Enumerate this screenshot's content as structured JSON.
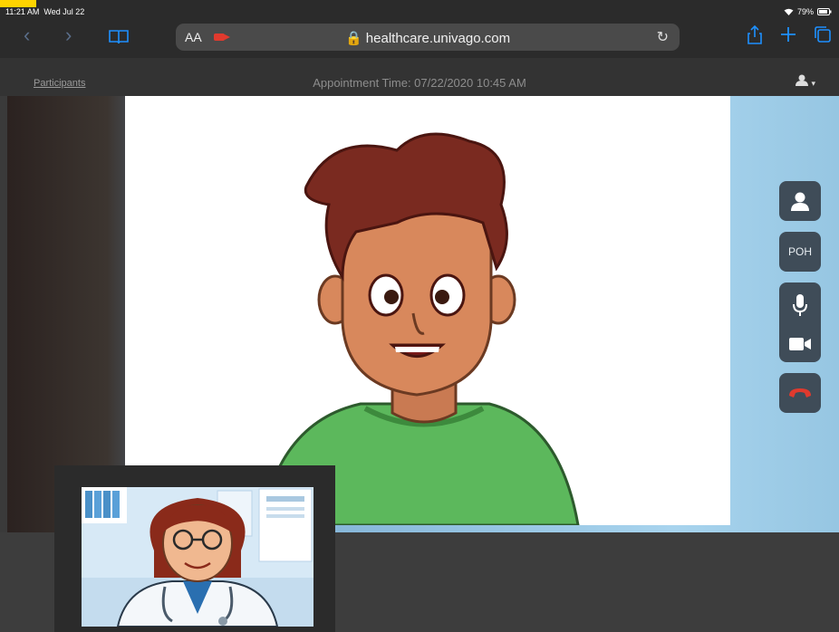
{
  "status_bar": {
    "time": "11:21 AM",
    "date": "Wed Jul 22",
    "battery": "79%",
    "wifi_icon": "wifi-icon",
    "battery_icon": "battery-icon"
  },
  "browser": {
    "text_size_label": "AA",
    "url": "healthcare.univago.com",
    "lock_icon": "lock-icon",
    "back_icon": "chevron-left-icon",
    "forward_icon": "chevron-right-icon",
    "bookmarks_icon": "book-icon",
    "reload_icon": "reload-icon",
    "share_icon": "share-icon",
    "new_tab_icon": "plus-icon",
    "tabs_icon": "tabs-icon",
    "accent": "#1e90ff"
  },
  "header": {
    "participants_label": "Participants",
    "appointment_label": "Appointment Time: 07/22/2020 10:45 AM",
    "user_icon": "user-icon"
  },
  "controls": {
    "poh_label": "POH",
    "end_call_color": "#e03a2e",
    "button_bg": "#3f4c58"
  }
}
